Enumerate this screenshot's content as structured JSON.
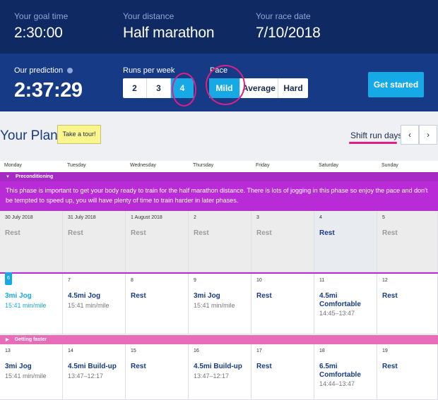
{
  "goals": [
    {
      "label": "Your goal time",
      "value": "2:30:00"
    },
    {
      "label": "Your distance",
      "value": "Half marathon"
    },
    {
      "label": "Your race date",
      "value": "7/10/2018"
    }
  ],
  "prediction": {
    "label": "Our prediction",
    "value": "2:37:29"
  },
  "runs_per_week": {
    "label": "Runs per week",
    "options": [
      "2",
      "3",
      "4"
    ],
    "selected": "4"
  },
  "pace": {
    "label": "Pace",
    "options": [
      "Mild",
      "Average",
      "Hard"
    ],
    "selected": "Mild"
  },
  "get_started": "Get started",
  "plan": {
    "title": "Your Plan",
    "tour": "Take a tour!",
    "shift": "Shift run days",
    "prev": "‹",
    "next": "›"
  },
  "days": [
    "Monday",
    "Tuesday",
    "Wednesday",
    "Thursday",
    "Friday",
    "Saturday",
    "Sunday"
  ],
  "phases": {
    "preconditioning": {
      "name": "Preconditioning",
      "description": "This phase is important to get your body ready to train for the half marathon distance. There is lots of jogging in this phase so enjoy the pace and don't be tempted to speed up, you will have plenty of time to train harder in later phases."
    },
    "getting_faster": {
      "name": "Getting faster"
    }
  },
  "weeks": [
    [
      {
        "date": "30 July 2018",
        "title": "Rest",
        "title2": "",
        "sub": ""
      },
      {
        "date": "31 July 2018",
        "title": "Rest",
        "title2": "",
        "sub": ""
      },
      {
        "date": "1 August 2018",
        "title": "Rest",
        "title2": "",
        "sub": ""
      },
      {
        "date": "2",
        "title": "Rest",
        "title2": "",
        "sub": ""
      },
      {
        "date": "3",
        "title": "Rest",
        "title2": "",
        "sub": ""
      },
      {
        "date": "4",
        "title": "Rest",
        "title2": "",
        "sub": ""
      },
      {
        "date": "5",
        "title": "Rest",
        "title2": "",
        "sub": ""
      }
    ],
    [
      {
        "date": "6",
        "title": "3mi Jog",
        "title2": "",
        "sub": "15:41 min/mile"
      },
      {
        "date": "7",
        "title": "4.5mi Jog",
        "title2": "",
        "sub": "15:41 min/mile"
      },
      {
        "date": "8",
        "title": "Rest",
        "title2": "",
        "sub": ""
      },
      {
        "date": "9",
        "title": "3mi Jog",
        "title2": "",
        "sub": "15:41 min/mile"
      },
      {
        "date": "10",
        "title": "Rest",
        "title2": "",
        "sub": ""
      },
      {
        "date": "11",
        "title": "4.5mi",
        "title2": "Comfortable",
        "sub": "14:45–13:47"
      },
      {
        "date": "12",
        "title": "Rest",
        "title2": "",
        "sub": ""
      }
    ],
    [
      {
        "date": "13",
        "title": "3mi Jog",
        "title2": "",
        "sub": "15:41 min/mile"
      },
      {
        "date": "14",
        "title": "4.5mi Build-up",
        "title2": "",
        "sub": "13:47–12:17"
      },
      {
        "date": "15",
        "title": "Rest",
        "title2": "",
        "sub": ""
      },
      {
        "date": "16",
        "title": "4.5mi Build-up",
        "title2": "",
        "sub": "13:47–12:17"
      },
      {
        "date": "17",
        "title": "Rest",
        "title2": "",
        "sub": ""
      },
      {
        "date": "18",
        "title": "6.5mi",
        "title2": "Comfortable",
        "sub": "14:44–13:47"
      },
      {
        "date": "19",
        "title": "Rest",
        "title2": "",
        "sub": ""
      }
    ]
  ],
  "colors": {
    "navy": "#0f2a63",
    "blue": "#163a85",
    "accent": "#17a9e6",
    "purple": "#b82bd6",
    "pink": "#e86cb8",
    "annotation": "#e01e88"
  }
}
